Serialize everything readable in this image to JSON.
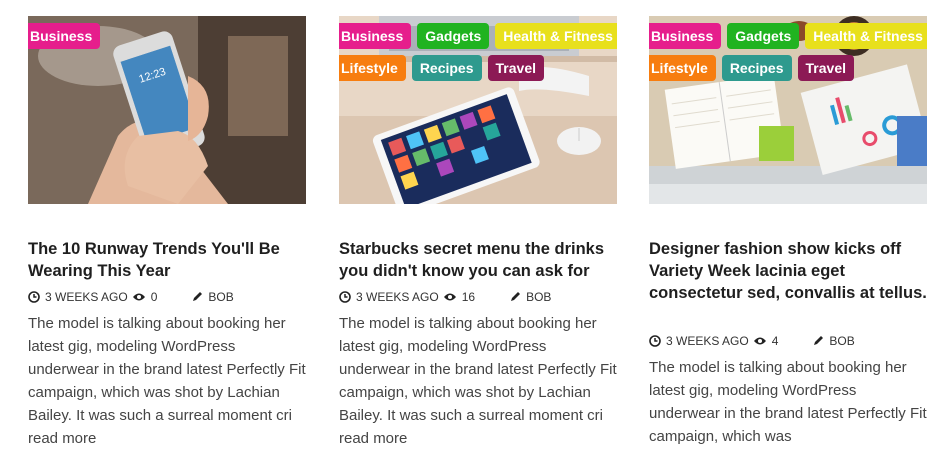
{
  "colors": {
    "business": "#e61e8c",
    "gadgets": "#20b320",
    "health": "#e8e01c",
    "lifestyle": "#f77d0f",
    "recipes": "#2e9a8e",
    "travel": "#8c1a55"
  },
  "posts": [
    {
      "image_icon": "phone-in-hand-photo",
      "tags": [
        "Business"
      ],
      "title": "The 10 Runway Trends You'll Be Wearing This Year",
      "time": "3 WEEKS AGO",
      "views": "0",
      "author": "BOB",
      "excerpt": "The model is talking about booking her latest gig, modeling WordPress underwear in the brand latest Perfectly Fit campaign, which was shot by Lachian Bailey. It was such a surreal moment cri read more"
    },
    {
      "image_icon": "tablet-on-desk-photo",
      "tags": [
        "Business",
        "Gadgets",
        "Health & Fitness",
        "Lifestyle",
        "Recipes",
        "Travel"
      ],
      "title": "Starbucks secret menu the drinks you didn't know you can ask for",
      "time": "3 WEEKS AGO",
      "views": "16",
      "author": "BOB",
      "excerpt": "The model is talking about booking her latest gig, modeling WordPress underwear in the brand latest Perfectly Fit campaign, which was shot by Lachian Bailey. It was such a surreal moment cri read more"
    },
    {
      "image_icon": "desk-with-charts-photo",
      "tags": [
        "Business",
        "Gadgets",
        "Health & Fitness",
        "Lifestyle",
        "Recipes",
        "Travel"
      ],
      "title": "Designer fashion show kicks off Variety Week lacinia eget consectetur sed, convallis at tellus.",
      "time": "3 WEEKS AGO",
      "views": "4",
      "author": "BOB",
      "excerpt": "The model is talking about booking her latest gig, modeling WordPress underwear in the brand latest Perfectly Fit campaign, which was"
    }
  ]
}
